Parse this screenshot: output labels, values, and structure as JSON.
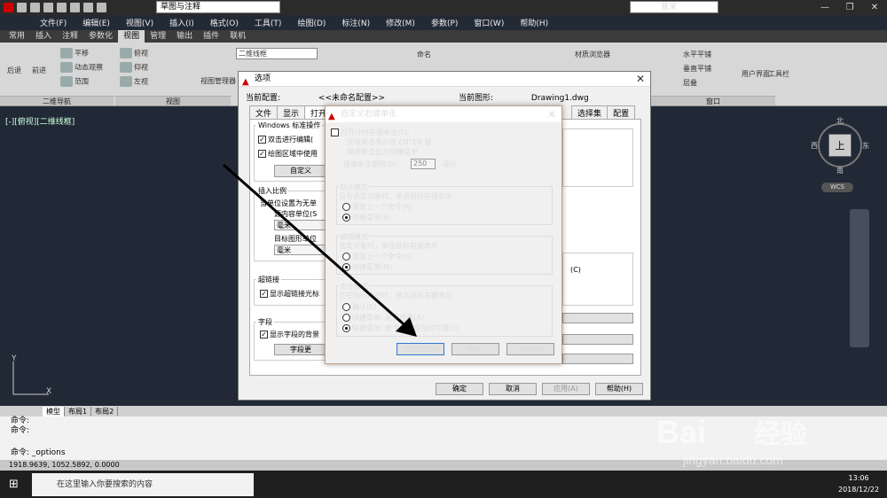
{
  "app": {
    "workspace": "草图与注释",
    "login": "登录"
  },
  "menus": [
    "文件(F)",
    "编辑(E)",
    "视图(V)",
    "插入(I)",
    "格式(O)",
    "工具(T)",
    "绘图(D)",
    "标注(N)",
    "修改(M)",
    "参数(P)",
    "窗口(W)",
    "帮助(H)"
  ],
  "ribbon_tabs": [
    "常用",
    "插入",
    "注释",
    "参数化",
    "视图",
    "管理",
    "输出",
    "插件",
    "联机"
  ],
  "ribbon": {
    "back": "后退",
    "forward": "前进",
    "pan": "平移",
    "dynamic": "动态观察",
    "range": "范围",
    "panel_nav": "二维导航",
    "views": [
      "俯视",
      "仰视",
      "左视"
    ],
    "view_manager": "视图管理器",
    "panel_view": "视图",
    "visual": "二维线框",
    "tile_h": "水平平铺",
    "tile_v": "垂直平铺",
    "cascade": "层叠",
    "user_interface": "用户界面",
    "toolbar": "工具栏",
    "panel_window": "窗口",
    "materials": "材质浏览器",
    "name": "命名"
  },
  "viewport_label": "[-][俯视][二维线框]",
  "viewcube": {
    "top": "上",
    "n": "北",
    "s": "南",
    "w": "西",
    "e": "东",
    "wcs": "WCS"
  },
  "layout_tabs": [
    "模型",
    "布局1",
    "布局2"
  ],
  "command_lines": [
    "命令:",
    "命令:",
    "命令: _options"
  ],
  "coords": "1918.9639, 1052.5892, 0.0000",
  "taskbar": {
    "search": "在这里输入你要搜索的内容",
    "time": "13:06",
    "date": "2018/12/22"
  },
  "options_dialog": {
    "title": "选项",
    "current_profile_label": "当前配置:",
    "current_profile": "<<未命名配置>>",
    "current_drawing_label": "当前图形:",
    "current_drawing": "Drawing1.dwg",
    "tabs": [
      "文件",
      "显示",
      "打开",
      "系统",
      "配置"
    ],
    "tab_mid": "选择集",
    "win_std": "Windows 标准操作",
    "dblclick": "双击进行编辑(",
    "shortcut_menu": "绘图区域中使用",
    "custom_btn": "自定义",
    "insert_scale": "插入比例",
    "unitless": "当单位设置为无单",
    "src_units": "源内容单位(S",
    "src_value": "毫米",
    "target_units": "目标图形单位",
    "target_value": "毫米",
    "hyperlink": "超链接",
    "hyperlink_chk": "显示超链接光标",
    "field": "字段",
    "field_chk": "显示字段的背景",
    "field_btn": "字段更",
    "c_label": "(C)",
    "ok": "确定",
    "cancel": "取消",
    "apply": "应用(A)",
    "help": "帮助(H)"
  },
  "right_click_dialog": {
    "title": "自定义右键单击",
    "timed": "打开计时右键单击(T):",
    "quick": "快速单击表示按 ENTER 键",
    "slow": "慢速单击显示快捷菜单",
    "duration_label": "慢速单击期限(D):",
    "duration": "250",
    "ms": "毫秒",
    "default_mode": "默认模式",
    "default_desc": "没有选定对象时，单击鼠标右键表示",
    "default_opts": [
      "重复上一个命令(R)",
      "快捷菜单(S)"
    ],
    "edit_mode": "编辑模式",
    "edit_desc": "选定对象时，单击鼠标右键表示",
    "edit_opts": [
      "重复上一个命令(L)",
      "快捷菜单(M)"
    ],
    "cmd_mode": "命令模式",
    "cmd_desc": "正在执行命令时，单击鼠标右键表示",
    "cmd_opts": [
      "确认(E)",
      "快捷菜单: 总是启用(A)",
      "快捷菜单: 命令选项存在时可用(C)"
    ],
    "apply_close": "应用并关闭",
    "cancel": "取消",
    "help": "帮助(H)"
  },
  "watermark": {
    "brand": "Bai",
    "brand2": "经验",
    "url": "jingyan.baidu.com"
  }
}
